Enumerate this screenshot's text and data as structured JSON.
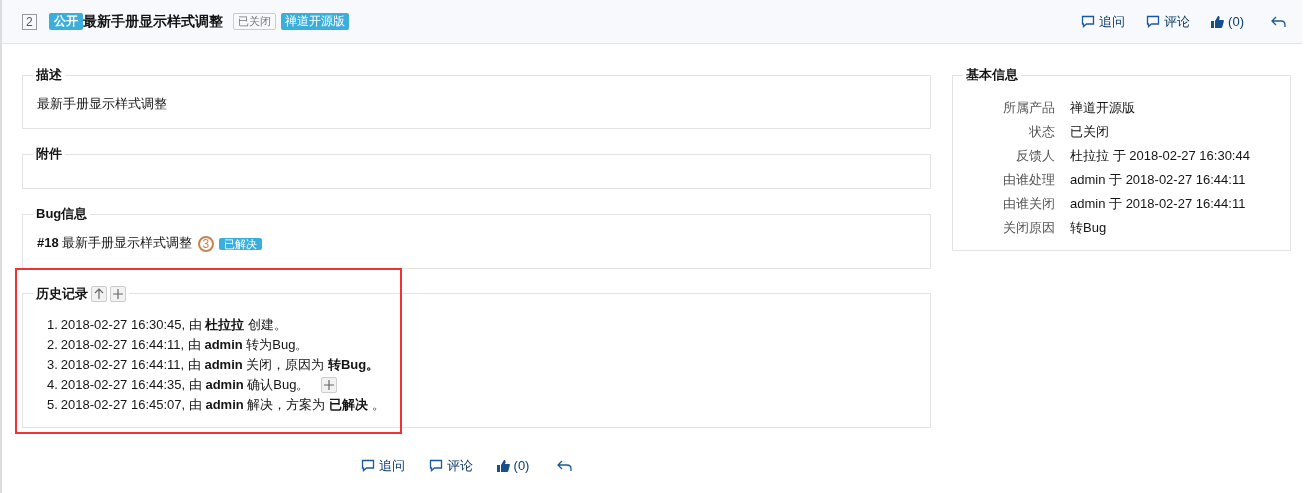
{
  "header": {
    "id": "2",
    "visibility": "公开",
    "title": "最新手册显示样式调整",
    "status": "已关闭",
    "product": "禅道开源版",
    "actions": [
      {
        "kind": "comment",
        "label": "追问"
      },
      {
        "kind": "comment",
        "label": "评论"
      },
      {
        "kind": "like",
        "label": "(0)"
      },
      {
        "kind": "back"
      }
    ]
  },
  "description": {
    "legend": "描述",
    "text": "最新手册显示样式调整"
  },
  "attachments": {
    "legend": "附件"
  },
  "bug_info": {
    "legend": "Bug信息",
    "id": "#18",
    "title": "最新手册显示样式调整",
    "priority": "3",
    "status": "已解决"
  },
  "history": {
    "legend": "历史记录",
    "highlighted": true,
    "entries": [
      {
        "number": "1.",
        "text": "2018-02-27 16:30:45, 由 **杜拉拉** 创建。",
        "expandable": false
      },
      {
        "number": "2.",
        "text": "2018-02-27 16:44:11, 由 **admin** 转为Bug。",
        "expandable": false
      },
      {
        "number": "3.",
        "text": "2018-02-27 16:44:11, 由 **admin** 关闭，原因为 **转Bug。**",
        "expandable": false
      },
      {
        "number": "4.",
        "text": "2018-02-27 16:44:35, 由 **admin** 确认Bug。",
        "expandable": true
      },
      {
        "number": "5.",
        "text": "2018-02-27 16:45:07, 由 **admin** 解决，方案为 **已解决** 。",
        "expandable": false
      }
    ]
  },
  "footer_actions": [
    {
      "kind": "comment",
      "label": "追问"
    },
    {
      "kind": "comment",
      "label": "评论"
    },
    {
      "kind": "like",
      "label": "(0)"
    },
    {
      "kind": "back"
    }
  ],
  "basic_info": {
    "legend": "基本信息",
    "rows": [
      {
        "label": "所属产品",
        "value": "禅道开源版"
      },
      {
        "label": "状态",
        "value": "已关闭"
      },
      {
        "label": "反馈人",
        "value": "杜拉拉 于 2018-02-27 16:30:44"
      },
      {
        "label": "由谁处理",
        "value": "admin 于 2018-02-27 16:44:11"
      },
      {
        "label": "由谁关闭",
        "value": "admin 于 2018-02-27 16:44:11"
      },
      {
        "label": "关闭原因",
        "value": "转Bug"
      }
    ]
  }
}
